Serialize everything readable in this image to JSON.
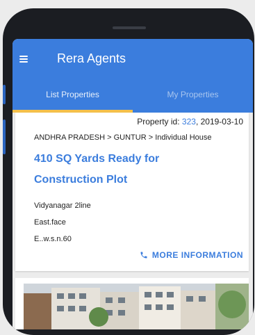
{
  "app": {
    "title": "Rera Agents"
  },
  "tabs": [
    {
      "label": "List Properties"
    },
    {
      "label": "My Properties"
    }
  ],
  "property": {
    "id_prefix": "Property id: ",
    "id": "323",
    "date_suffix": ", 2019-03-10",
    "breadcrumb": "ANDHRA PRADESH > GUNTUR > Individual House",
    "title": "410 SQ Yards Ready for Construction Plot",
    "details": [
      "Vidyanagar 2line",
      "East.face",
      "E..w.s.n.60"
    ],
    "more_label": "MORE INFORMATION"
  },
  "colors": {
    "primary": "#3b7ddd",
    "accent": "#f5c04a",
    "phone_body": "#1b1d22"
  },
  "icons": {
    "menu": "menu-icon",
    "phone": "phone-icon"
  }
}
